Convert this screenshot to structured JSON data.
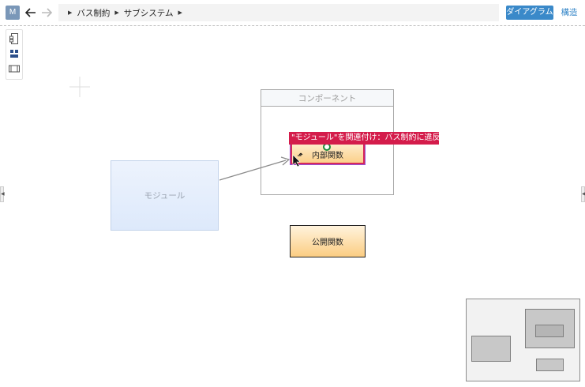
{
  "header": {
    "avatar_letter": "M",
    "breadcrumb": [
      "バス制約",
      "サブシステム"
    ],
    "diagram_button": "ダイアグラム",
    "structure_link": "構造"
  },
  "diagram": {
    "module_label": "モジュール",
    "component_label": "コンポーネント",
    "internal_function_label": "内部関数",
    "public_function_label": "公開関数",
    "error_message": "\"モジュール\"を関連付け：バス制約に違反します"
  },
  "colors": {
    "accent": "#3a89c9",
    "error": "#d41c4b",
    "module_fill": "#e3ecfb",
    "function_fill": "#fbd08a"
  },
  "icons": [
    "back-arrow-icon",
    "forward-arrow-icon",
    "frame-icon",
    "components-icon",
    "panel-icon",
    "crosshair-icon",
    "link-cursor-icon"
  ]
}
